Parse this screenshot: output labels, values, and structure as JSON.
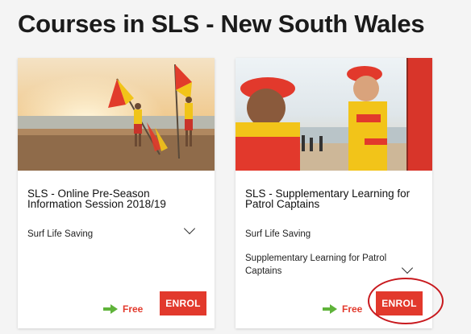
{
  "page": {
    "title": "Courses in SLS - New South Wales"
  },
  "courses": [
    {
      "title": "SLS - Online Pre-Season Information Session 2018/19",
      "provider": "Surf Life Saving",
      "description": "",
      "price": "Free",
      "enrol_label": "ENROL",
      "image_icon": "beach-flags-image"
    },
    {
      "title": "SLS - Supplementary Learning for Patrol Captains",
      "provider": "Surf Life Saving",
      "description": "Supplementary Learning for Patrol Captains",
      "price": "Free",
      "enrol_label": "ENROL",
      "image_icon": "lifeguards-image"
    }
  ],
  "colors": {
    "accent": "#e2392c",
    "price_arrow": "#5fb33a",
    "highlight": "#c8191e"
  }
}
